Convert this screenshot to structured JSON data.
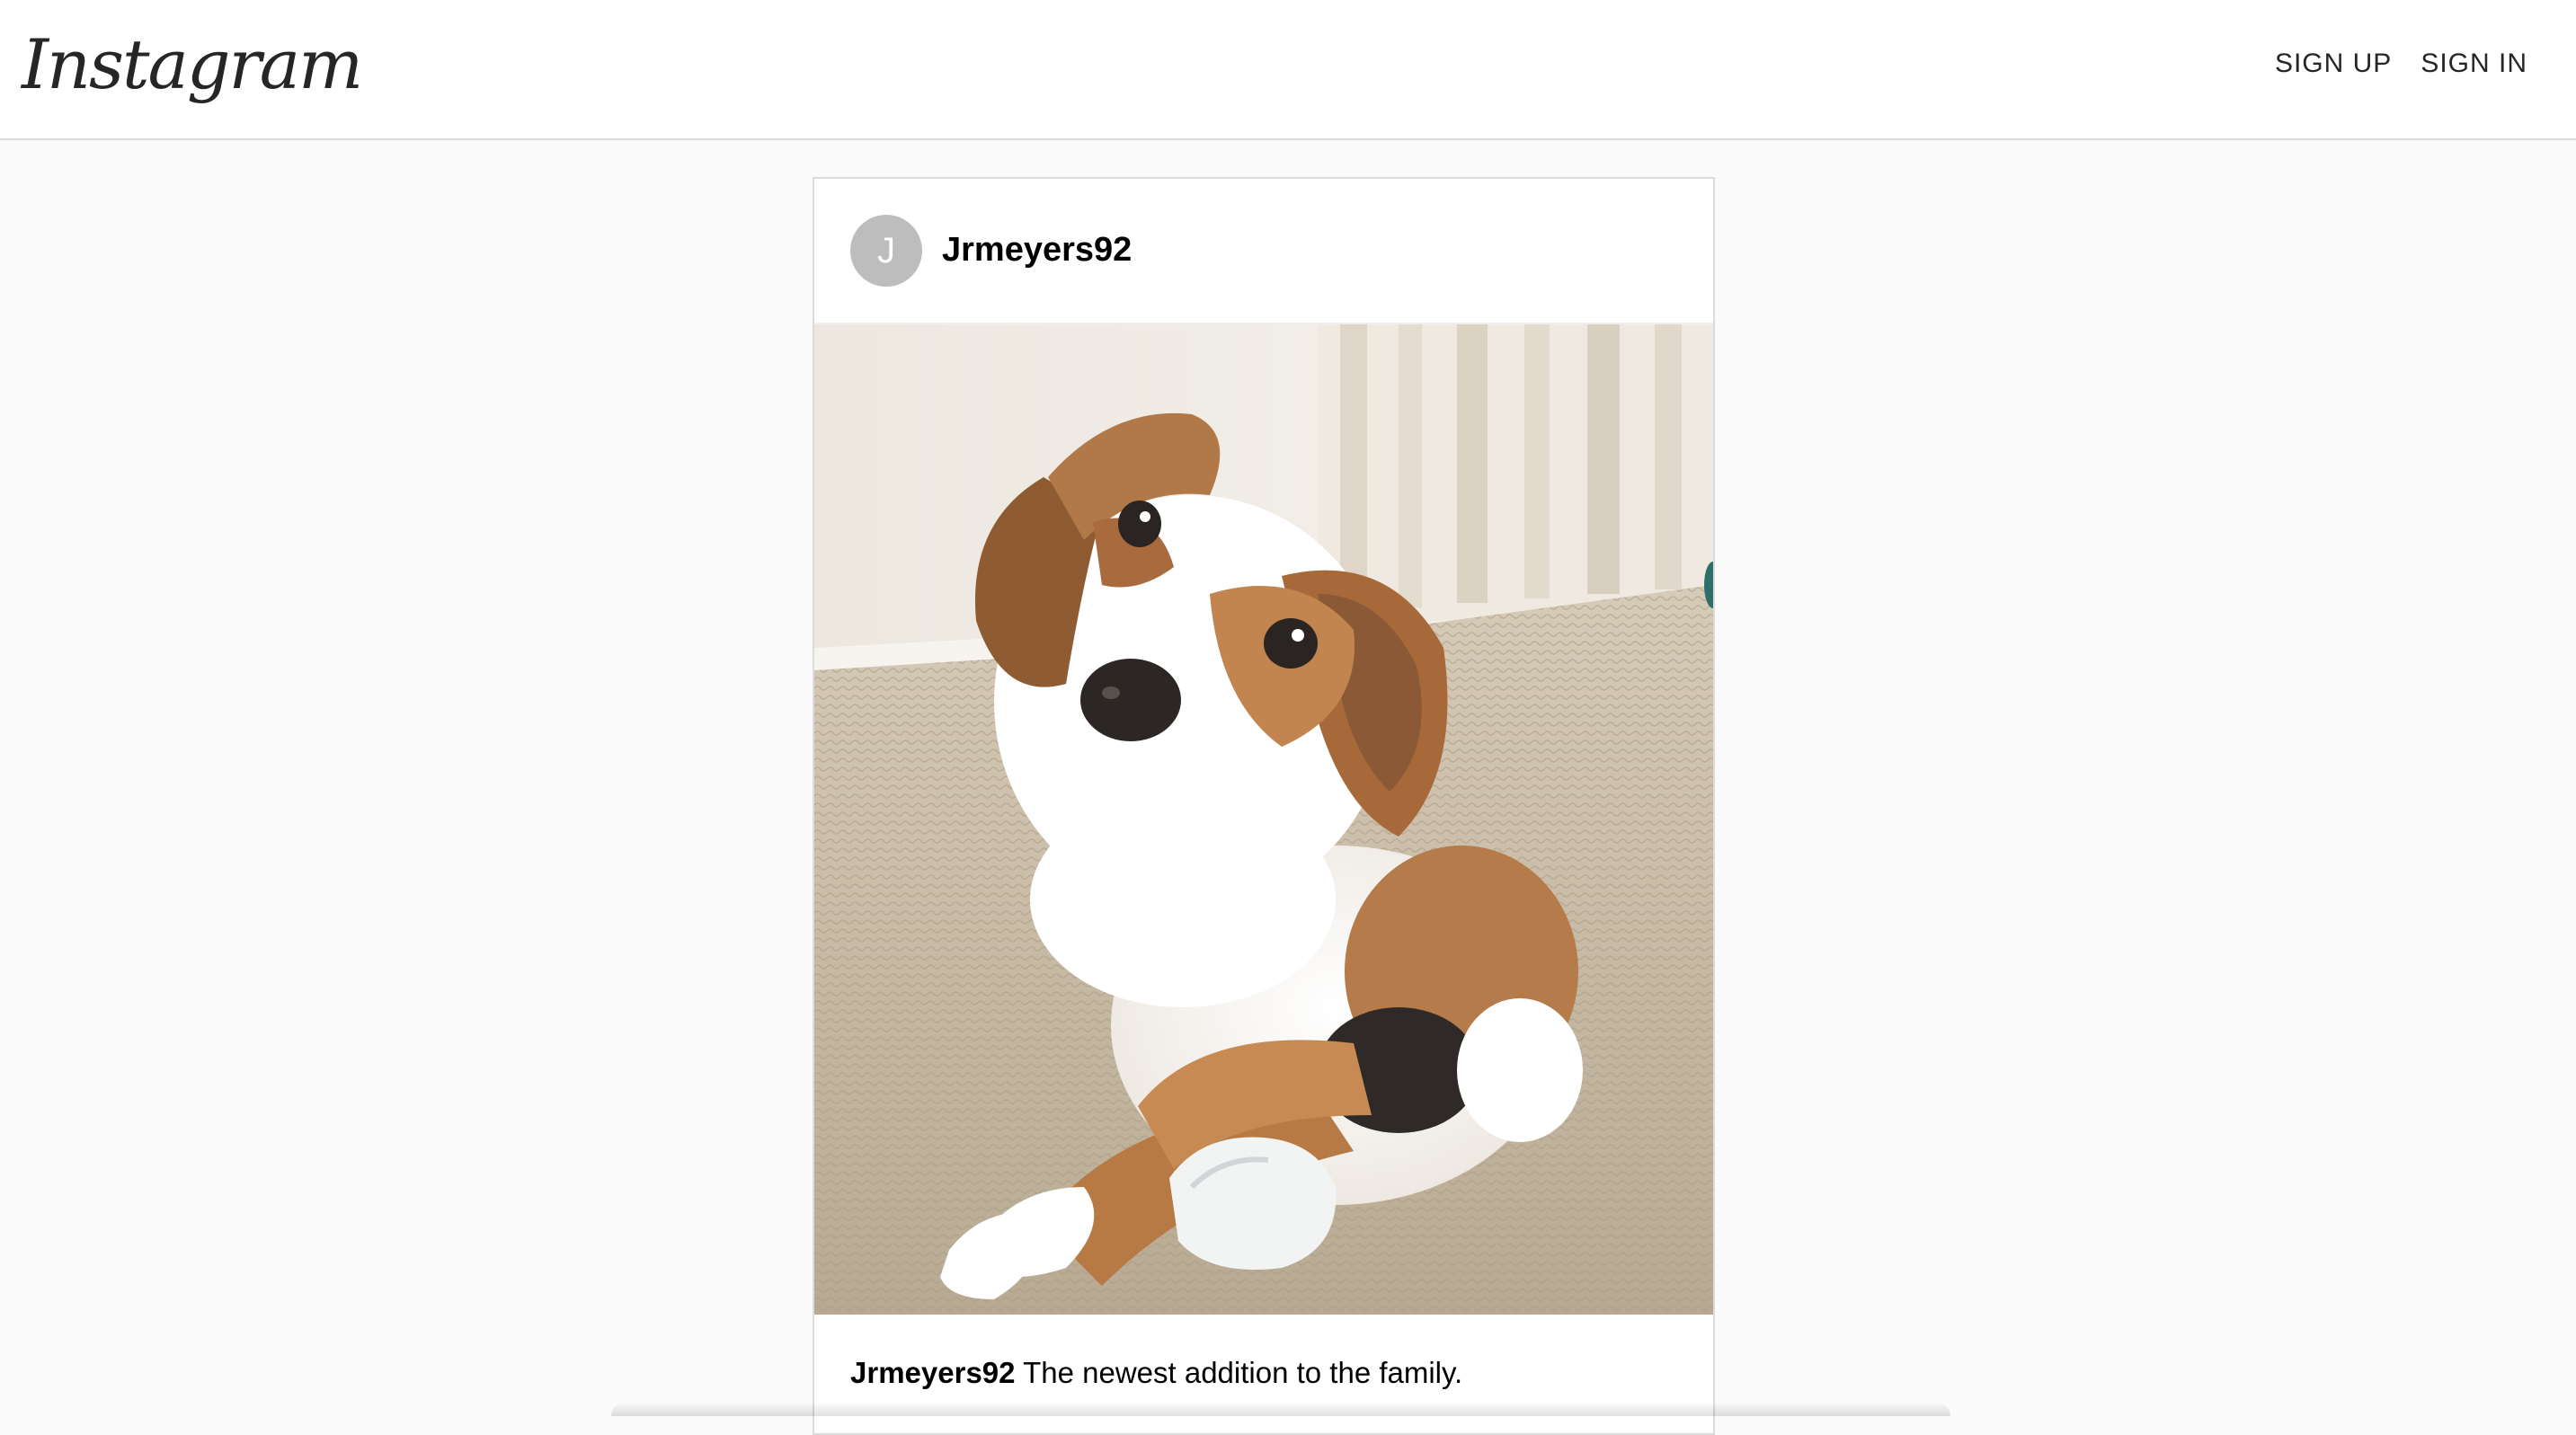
{
  "header": {
    "logo_text": "Instagram",
    "nav": {
      "sign_up": "SIGN UP",
      "sign_in": "SIGN IN"
    }
  },
  "post": {
    "avatar_initial": "J",
    "username": "Jrmeyers92",
    "caption_user": "Jrmeyers92",
    "caption_text": "The newest addition to the family.",
    "image_alt": "puppy"
  }
}
